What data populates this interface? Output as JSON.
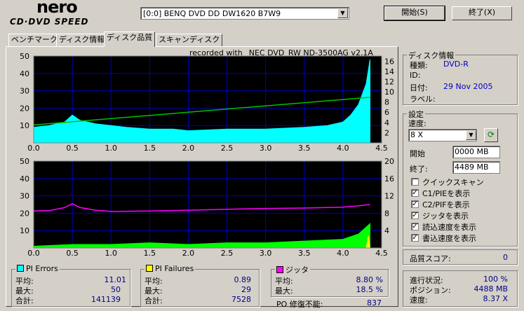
{
  "logo": {
    "top": "nero",
    "sub": "CD·DVD SPEED"
  },
  "drive": {
    "selected": "[0:0]   BENQ DVD DD DW1620 B7W9"
  },
  "buttons": {
    "start": "開始(S)",
    "end": "終了(X)"
  },
  "tabs": [
    "ベンチマーク",
    "ディスク情報",
    "ディスク品質",
    "スキャンディスク"
  ],
  "active_tab": 2,
  "recorded_with": "recorded with _NEC     DVD_RW ND-3500AG v2.1A",
  "disc_info": {
    "title": "ディスク情報",
    "type_label": "種類:",
    "type_value": "DVD-R",
    "id_label": "ID:",
    "id_value": "",
    "date_label": "日付:",
    "date_value": "29 Nov 2005",
    "label_label": "ラベル:",
    "label_value": ""
  },
  "settings": {
    "title": "設定",
    "speed_label": "速度:",
    "speed_value": "8 X",
    "start_label": "開始",
    "start_value": "0000 MB",
    "end_label": "終了:",
    "end_value": "4489 MB",
    "checks": [
      {
        "label": "クイックスキャン",
        "checked": false
      },
      {
        "label": "C1/PIEを表示",
        "checked": true
      },
      {
        "label": "C2/PIFを表示",
        "checked": true
      },
      {
        "label": "ジッタを表示",
        "checked": true
      },
      {
        "label": "読込速度を表示",
        "checked": true
      },
      {
        "label": "書込速度を表示",
        "checked": true
      }
    ]
  },
  "quality": {
    "label": "品質スコア:",
    "value": "0"
  },
  "progress": {
    "status_label": "進行状況:",
    "status_value": "100 %",
    "position_label": "ポジション:",
    "position_value": "4488 MB",
    "speed_label": "速度:",
    "speed_value": "8.37 X"
  },
  "pi_errors": {
    "title": "PI Errors",
    "color": "#00ffff",
    "avg_label": "平均:",
    "avg": "11.01",
    "max_label": "最大:",
    "max": "50",
    "total_label": "合計:",
    "total": "141139"
  },
  "pi_failures": {
    "title": "PI Failures",
    "color": "#ffff00",
    "avg_label": "平均:",
    "avg": "0.89",
    "max_label": "最大:",
    "max": "29",
    "total_label": "合計:",
    "total": "7528"
  },
  "jitter": {
    "title": "ジッタ",
    "color": "#ff00ff",
    "avg_label": "平均:",
    "avg": "8.80 %",
    "max_label": "最大:",
    "max": "18.5 %"
  },
  "po": {
    "label": "PO 修復不能:",
    "value": "837"
  },
  "chart_data": [
    {
      "type": "area",
      "x_ticks": [
        "0.0",
        "0.5",
        "1.0",
        "1.5",
        "2.0",
        "2.5",
        "3.0",
        "3.5",
        "4.0",
        "4.5"
      ],
      "y_left_ticks": [
        "50",
        "40",
        "30",
        "20",
        "10"
      ],
      "y_right_ticks": [
        "16",
        "14",
        "12",
        "10",
        "8",
        "6",
        "4",
        "2"
      ],
      "xlim": [
        0,
        4.5
      ],
      "ylim": [
        0,
        50
      ],
      "y2lim": [
        0,
        16
      ],
      "series": [
        {
          "values_desc": "pie",
          "x": [
            0,
            0.2,
            0.4,
            0.5,
            0.6,
            0.8,
            1.0,
            1.2,
            1.5,
            1.8,
            2.0,
            2.5,
            3.0,
            3.5,
            3.8,
            4.0,
            4.1,
            4.2,
            4.3,
            4.35
          ],
          "y": [
            9,
            10,
            12,
            16,
            13,
            11,
            10,
            9,
            8,
            8,
            7,
            8,
            8,
            9,
            10,
            12,
            16,
            22,
            34,
            48
          ],
          "color": "#00ffff"
        },
        {
          "values_desc": "read-speed",
          "x": [
            0,
            4.35
          ],
          "y": [
            3.3,
            8.4
          ],
          "color": "#00c000"
        }
      ]
    },
    {
      "type": "area",
      "x_ticks": [
        "0.0",
        "0.5",
        "1.0",
        "1.5",
        "2.0",
        "2.5",
        "3.0",
        "3.5",
        "4.0",
        "4.5"
      ],
      "y_left_ticks": [
        "50",
        "40",
        "30",
        "20",
        "10"
      ],
      "y_right_ticks": [
        "20",
        "16",
        "12",
        "8",
        "4"
      ],
      "xlim": [
        0,
        4.5
      ],
      "ylim": [
        0,
        50
      ],
      "y2lim": [
        0,
        20
      ],
      "series": [
        {
          "values_desc": "pif",
          "x": [
            0,
            0.5,
            1.0,
            1.5,
            2.0,
            2.5,
            3.0,
            3.5,
            4.0,
            4.2,
            4.35
          ],
          "y": [
            1,
            2,
            2,
            3,
            2,
            3,
            3,
            4,
            5,
            8,
            14
          ],
          "color": "#00ff00"
        },
        {
          "values_desc": "jitter",
          "x": [
            0,
            0.2,
            0.4,
            0.5,
            0.6,
            0.8,
            1.0,
            1.5,
            2.0,
            2.5,
            3.0,
            3.5,
            4.0,
            4.2,
            4.35
          ],
          "y": [
            8.5,
            8.6,
            9.3,
            10.2,
            9.3,
            8.7,
            8.4,
            8.5,
            8.7,
            8.9,
            9.1,
            9.2,
            9.4,
            9.7,
            10.0
          ],
          "color": "#ff00ff"
        },
        {
          "values_desc": "pif-yellow",
          "x": [
            4.3,
            4.33,
            4.35
          ],
          "y": [
            0,
            7,
            0
          ],
          "color": "#ffff00"
        }
      ]
    }
  ]
}
